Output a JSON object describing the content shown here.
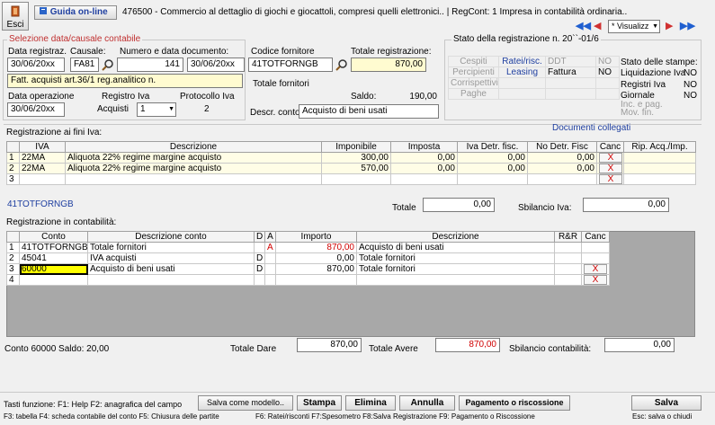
{
  "toolbar": {
    "esci_label": "Esci",
    "guida_label": "Guida on-line",
    "title": "476500 - Commercio al dettaglio di giochi e giocattoli, compresi quelli elettronici.. | RegCont: 1 Impresa  in contabilità ordinaria..",
    "view_select": "* Visualizz"
  },
  "selezione": {
    "legend": "Selezione data/causale contabile",
    "data_reg_label": "Data registraz.",
    "data_reg": "30/06/20xx",
    "causale_label": "Causale:",
    "causale": "FA81",
    "numero_label": "Numero e data documento:",
    "numero": "141",
    "data_doc": "30/06/20xx",
    "descr_causale": "Fatt. acquisti art.36/1 reg.analitico n.",
    "data_op_label": "Data operazione",
    "data_op": "30/06/20xx",
    "registro_label": "Registro Iva",
    "registro_tipo": "Acquisti",
    "registro_num": "1",
    "protocollo_label": "Protocollo Iva",
    "protocollo": "2"
  },
  "fornitore": {
    "codice_label": "Codice fornitore",
    "codice": "41TOTFORNGB",
    "totale_reg_label": "Totale registrazione:",
    "totale_reg": "870,00",
    "nome": "Totale fornitori",
    "saldo_label": "Saldo:",
    "saldo": "190,00",
    "descr_conto_label": "Descr. conto",
    "descr_conto": "Acquisto di beni usati"
  },
  "stato": {
    "legend": "Stato della registrazione n. 20``-01/6",
    "rows": [
      [
        "Cespiti",
        "Ratei/risc.",
        "DDT",
        "NO"
      ],
      [
        "Percipienti",
        "Leasing",
        "Fattura",
        "NO"
      ],
      [
        "Corrispettivi",
        "",
        "",
        ""
      ],
      [
        "Paghe",
        "",
        "",
        ""
      ]
    ],
    "stampe_title": "Stato delle stampe:",
    "stampe": [
      {
        "label": "Liquidazione Iva",
        "value": "NO"
      },
      {
        "label": "Registri Iva",
        "value": "NO"
      },
      {
        "label": "Giornale",
        "value": "NO"
      },
      {
        "label": "Inc. e pag. Mov. fin.",
        "value": ""
      }
    ]
  },
  "iva": {
    "title": "Registrazione ai fini Iva:",
    "documenti_link": "Documenti collegati",
    "headers": [
      "",
      "IVA",
      "Descrizione",
      "Imponibile",
      "Imposta",
      "Iva Detr. fisc.",
      "No Detr. Fisc",
      "Canc",
      "Rip. Acq./Imp."
    ],
    "rows": [
      {
        "n": "1",
        "iva": "22MA",
        "descr": "Aliquota 22% regime margine acquisto",
        "imponibile": "300,00",
        "imposta": "0,00",
        "detr": "0,00",
        "nodetr": "0,00",
        "canc": "X"
      },
      {
        "n": "2",
        "iva": "22MA",
        "descr": "Aliquota 22% regime margine acquisto",
        "imponibile": "570,00",
        "imposta": "0,00",
        "detr": "0,00",
        "nodetr": "0,00",
        "canc": "X"
      },
      {
        "n": "3",
        "iva": "",
        "descr": "",
        "imponibile": "",
        "imposta": "",
        "detr": "",
        "nodetr": "",
        "canc": "X"
      }
    ],
    "footer_code": "41TOTFORNGB",
    "totale_label": "Totale",
    "totale": "0,00",
    "sbilancio_label": "Sbilancio Iva:",
    "sbilancio": "0,00"
  },
  "contabilita": {
    "title": "Registrazione in contabilità:",
    "headers": [
      "",
      "Conto",
      "Descrizione conto",
      "D",
      "A",
      "Importo",
      "Descrizione",
      "R&R",
      "Canc"
    ],
    "rows": [
      {
        "n": "1",
        "conto": "41TOTFORNGB",
        "descr_conto": "Totale fornitori",
        "d": "",
        "a": "A",
        "importo": "870,00",
        "descr": "Acquisto di beni usati",
        "canc": ""
      },
      {
        "n": "2",
        "conto": "45041",
        "descr_conto": "IVA acquisti",
        "d": "D",
        "a": "",
        "importo": "0,00",
        "descr": "Totale fornitori",
        "canc": ""
      },
      {
        "n": "3",
        "conto": "60000",
        "descr_conto": "Acquisto di beni usati",
        "d": "D",
        "a": "",
        "importo": "870,00",
        "descr": "Totale fornitori",
        "canc": "X"
      },
      {
        "n": "4",
        "conto": "",
        "descr_conto": "",
        "d": "",
        "a": "",
        "importo": "",
        "descr": "",
        "canc": "X"
      }
    ],
    "conto_saldo": "Conto 60000 Saldo: 20,00",
    "tot_dare_label": "Totale Dare",
    "tot_dare": "870,00",
    "tot_avere_label": "Totale Avere",
    "tot_avere": "870,00",
    "sbilancio_label": "Sbilancio contabilità:",
    "sbilancio": "0,00"
  },
  "bottom": {
    "help1": "Tasti funzione:  F1: Help  F2: anagrafica del campo",
    "salva_modello": "Salva come modello..",
    "stampa": "Stampa",
    "elimina": "Elimina",
    "annulla": "Annulla",
    "pagamento": "Pagamento o riscossione",
    "salva": "Salva",
    "help2": "F3: tabella   F4: scheda contabile del conto  F5: Chiusura delle partite",
    "help3": "F6: Ratei/risconti  F7:Spesometro  F8:Salva Registrazione   F9: Pagamento o Riscossione",
    "esc_hint": "Esc: salva o chiudi"
  },
  "colors": {
    "accent": "#1f3fa0",
    "red": "#d00000",
    "nav": "#1f5fd0"
  }
}
